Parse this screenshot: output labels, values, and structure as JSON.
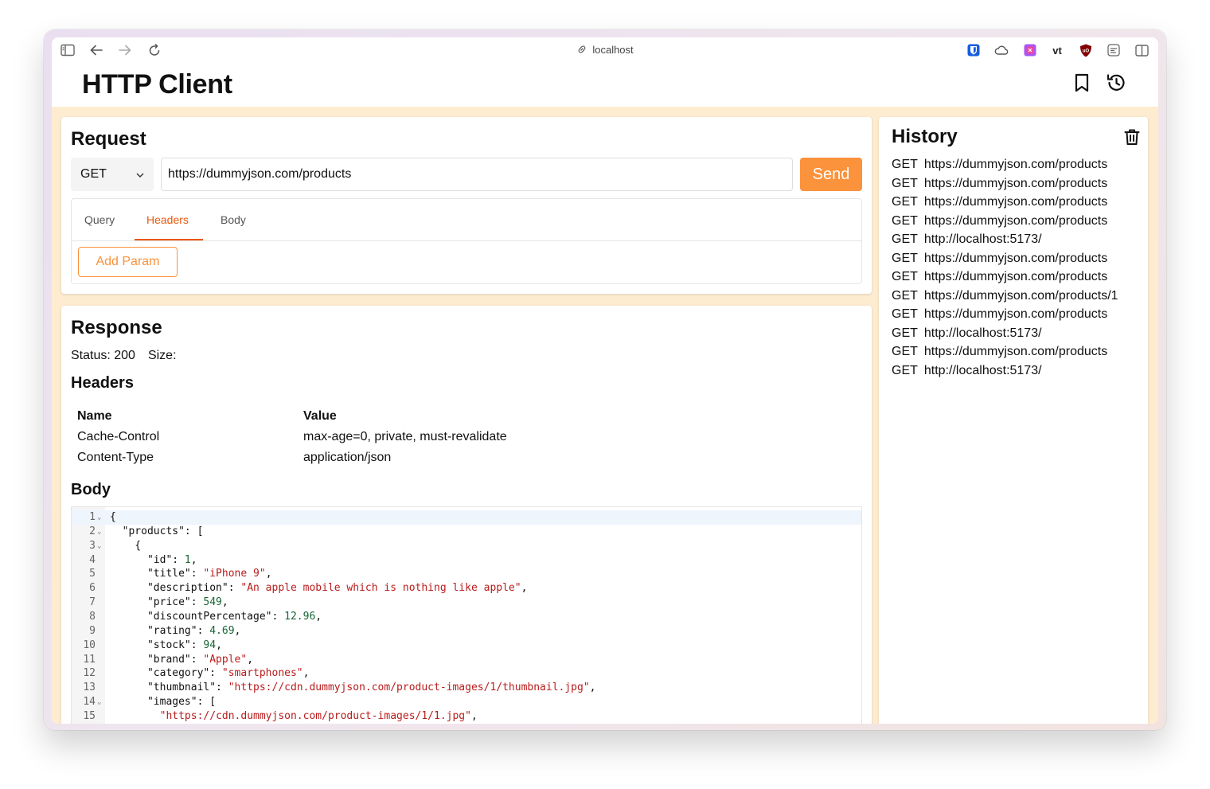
{
  "browser": {
    "address": "localhost"
  },
  "app": {
    "title": "HTTP Client"
  },
  "request": {
    "heading": "Request",
    "method": "GET",
    "url": "https://dummyjson.com/products",
    "send_label": "Send",
    "tabs": [
      {
        "label": "Query"
      },
      {
        "label": "Headers"
      },
      {
        "label": "Body"
      }
    ],
    "active_tab": "Headers",
    "add_param_label": "Add Param"
  },
  "response": {
    "heading": "Response",
    "status_text": "Status: 200",
    "size_text": "Size:",
    "headers_heading": "Headers",
    "headers_columns": [
      "Name",
      "Value"
    ],
    "headers_rows": [
      {
        "name": "Cache-Control",
        "value": "max-age=0, private, must-revalidate"
      },
      {
        "name": "Content-Type",
        "value": "application/json"
      }
    ],
    "body_heading": "Body",
    "body_lines": [
      {
        "n": "1",
        "fold": true,
        "parts": [
          {
            "t": "{",
            "c": ""
          }
        ]
      },
      {
        "n": "2",
        "fold": true,
        "parts": [
          {
            "t": "  \"products\": [",
            "c": ""
          }
        ]
      },
      {
        "n": "3",
        "fold": true,
        "parts": [
          {
            "t": "    {",
            "c": ""
          }
        ]
      },
      {
        "n": "4",
        "fold": false,
        "parts": [
          {
            "t": "      \"id\": ",
            "c": ""
          },
          {
            "t": "1",
            "c": "num"
          },
          {
            "t": ",",
            "c": ""
          }
        ]
      },
      {
        "n": "5",
        "fold": false,
        "parts": [
          {
            "t": "      \"title\": ",
            "c": ""
          },
          {
            "t": "\"iPhone 9\"",
            "c": "str"
          },
          {
            "t": ",",
            "c": ""
          }
        ]
      },
      {
        "n": "6",
        "fold": false,
        "parts": [
          {
            "t": "      \"description\": ",
            "c": ""
          },
          {
            "t": "\"An apple mobile which is nothing like apple\"",
            "c": "str"
          },
          {
            "t": ",",
            "c": ""
          }
        ]
      },
      {
        "n": "7",
        "fold": false,
        "parts": [
          {
            "t": "      \"price\": ",
            "c": ""
          },
          {
            "t": "549",
            "c": "num"
          },
          {
            "t": ",",
            "c": ""
          }
        ]
      },
      {
        "n": "8",
        "fold": false,
        "parts": [
          {
            "t": "      \"discountPercentage\": ",
            "c": ""
          },
          {
            "t": "12.96",
            "c": "num"
          },
          {
            "t": ",",
            "c": ""
          }
        ]
      },
      {
        "n": "9",
        "fold": false,
        "parts": [
          {
            "t": "      \"rating\": ",
            "c": ""
          },
          {
            "t": "4.69",
            "c": "num"
          },
          {
            "t": ",",
            "c": ""
          }
        ]
      },
      {
        "n": "10",
        "fold": false,
        "parts": [
          {
            "t": "      \"stock\": ",
            "c": ""
          },
          {
            "t": "94",
            "c": "num"
          },
          {
            "t": ",",
            "c": ""
          }
        ]
      },
      {
        "n": "11",
        "fold": false,
        "parts": [
          {
            "t": "      \"brand\": ",
            "c": ""
          },
          {
            "t": "\"Apple\"",
            "c": "str"
          },
          {
            "t": ",",
            "c": ""
          }
        ]
      },
      {
        "n": "12",
        "fold": false,
        "parts": [
          {
            "t": "      \"category\": ",
            "c": ""
          },
          {
            "t": "\"smartphones\"",
            "c": "str"
          },
          {
            "t": ",",
            "c": ""
          }
        ]
      },
      {
        "n": "13",
        "fold": false,
        "parts": [
          {
            "t": "      \"thumbnail\": ",
            "c": ""
          },
          {
            "t": "\"https://cdn.dummyjson.com/product-images/1/thumbnail.jpg\"",
            "c": "str"
          },
          {
            "t": ",",
            "c": ""
          }
        ]
      },
      {
        "n": "14",
        "fold": true,
        "parts": [
          {
            "t": "      \"images\": [",
            "c": ""
          }
        ]
      },
      {
        "n": "15",
        "fold": false,
        "parts": [
          {
            "t": "        ",
            "c": ""
          },
          {
            "t": "\"https://cdn.dummyjson.com/product-images/1/1.jpg\"",
            "c": "str"
          },
          {
            "t": ",",
            "c": ""
          }
        ]
      }
    ]
  },
  "history": {
    "heading": "History",
    "items": [
      {
        "method": "GET",
        "url": "https://dummyjson.com/products"
      },
      {
        "method": "GET",
        "url": "https://dummyjson.com/products"
      },
      {
        "method": "GET",
        "url": "https://dummyjson.com/products"
      },
      {
        "method": "GET",
        "url": "https://dummyjson.com/products"
      },
      {
        "method": "GET",
        "url": "http://localhost:5173/"
      },
      {
        "method": "GET",
        "url": "https://dummyjson.com/products"
      },
      {
        "method": "GET",
        "url": "https://dummyjson.com/products"
      },
      {
        "method": "GET",
        "url": "https://dummyjson.com/products/1"
      },
      {
        "method": "GET",
        "url": "https://dummyjson.com/products"
      },
      {
        "method": "GET",
        "url": "http://localhost:5173/"
      },
      {
        "method": "GET",
        "url": "https://dummyjson.com/products"
      },
      {
        "method": "GET",
        "url": "http://localhost:5173/"
      }
    ]
  },
  "colors": {
    "accent": "#fb923c",
    "accent_dark": "#ea580c",
    "page_background": "#fdecd0"
  },
  "icons": {
    "browser": [
      "sidebar-icon",
      "back-arrow-icon",
      "forward-arrow-icon",
      "reload-icon",
      "link-icon"
    ],
    "extensions": [
      "bitwarden-icon",
      "cloud-icon",
      "extension-icon",
      "vt-icon",
      "ublock-icon",
      "reader-icon",
      "split-view-icon"
    ],
    "app": [
      "bookmark-icon",
      "history-icon",
      "trash-icon"
    ]
  },
  "extensions": {
    "vt_label": "vt"
  }
}
